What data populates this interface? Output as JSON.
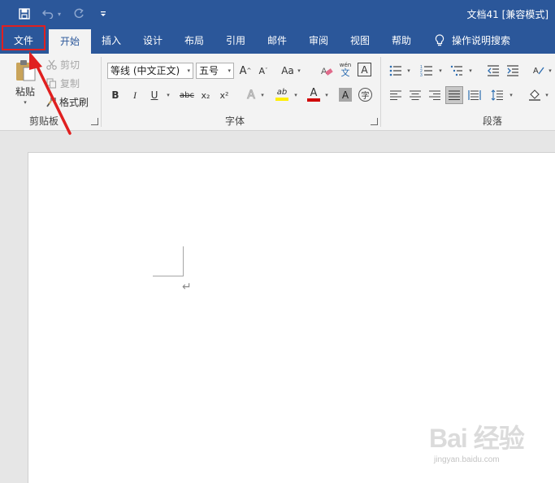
{
  "title_bar": {
    "document_title": "文档41 [兼容模式]",
    "background_color": "#2b579a",
    "quick_access": [
      {
        "name": "save",
        "icon": "save-icon"
      },
      {
        "name": "undo",
        "icon": "undo-icon"
      },
      {
        "name": "redo",
        "icon": "redo-icon"
      },
      {
        "name": "customize",
        "icon": "chevron-down-icon"
      }
    ]
  },
  "tabs": [
    {
      "label": "文件"
    },
    {
      "label": "开始",
      "active": true
    },
    {
      "label": "插入"
    },
    {
      "label": "设计"
    },
    {
      "label": "布局"
    },
    {
      "label": "引用"
    },
    {
      "label": "邮件"
    },
    {
      "label": "审阅"
    },
    {
      "label": "视图"
    },
    {
      "label": "帮助"
    },
    {
      "label": "操作说明搜索",
      "icon": "lightbulb-icon"
    }
  ],
  "clipboard": {
    "paste_label": "粘贴",
    "cut_label": "剪切",
    "copy_label": "复制",
    "format_painter_label": "格式刷",
    "group_label": "剪贴板"
  },
  "font": {
    "font_name": "等线 (中文正文)",
    "font_size": "五号",
    "change_case_label": "Aa",
    "phonetic_top": "wén",
    "phonetic_bottom": "文",
    "bold": "B",
    "italic": "I",
    "underline": "U",
    "strikethrough": "abc",
    "subscript": "x₂",
    "superscript": "x²",
    "text_effects": "A",
    "highlight": "ab",
    "font_color": "A",
    "char_shading": "A",
    "enclose": "字",
    "group_label": "字体",
    "font_color_value": "#d00000",
    "highlight_color_value": "#ffee00"
  },
  "paragraph": {
    "group_label": "段落"
  },
  "document": {
    "paragraph_mark": "↵"
  },
  "watermark": {
    "logo": "Bai 经验",
    "url": "jingyan.baidu.com"
  },
  "annotation": {
    "highlight_color": "#e02020"
  }
}
